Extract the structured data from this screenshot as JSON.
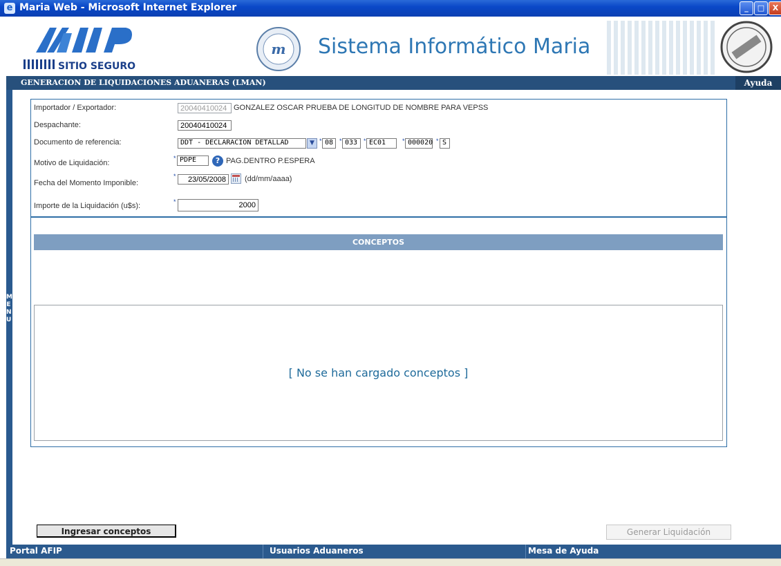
{
  "window": {
    "title": "Maria Web - Microsoft Internet Explorer",
    "min_glyph": "_",
    "max_glyph": "□",
    "close_glyph": "X"
  },
  "header": {
    "logo_text": "AFIP",
    "logo_subtext": "SITIO SEGURO",
    "system_title": "Sistema Informático Maria"
  },
  "section": {
    "title": "GENERACION DE LIQUIDACIONES ADUANERAS (LMAN)",
    "help_label": "Ayuda",
    "menu_label": "MENU"
  },
  "form": {
    "importador": {
      "label": "Importador / Exportador:",
      "cuit": "20040410024",
      "name": "GONZALEZ OSCAR PRUEBA DE LONGITUD DE NOMBRE PARA VEPSS"
    },
    "despachante": {
      "label": "Despachante:",
      "value": "20040410024"
    },
    "documento": {
      "label": "Documento de referencia:",
      "type_selected": "DDT - DECLARACION DETALLAD",
      "f1": "08",
      "f2": "033",
      "f3": "EC01",
      "f4": "000020",
      "f5": "S"
    },
    "motivo": {
      "label": "Motivo de Liquidación:",
      "value": "PDPE",
      "description": "PAG.DENTRO P.ESPERA"
    },
    "fecha": {
      "label": "Fecha del Momento Imponible:",
      "value": "23/05/2008",
      "format_hint": "(dd/mm/aaaa)"
    },
    "importe": {
      "label": "Importe de la Liquidación (u$s):",
      "value": "2000"
    },
    "required_mark": "*"
  },
  "conceptos": {
    "header": "CONCEPTOS",
    "empty_message": "[ No se han cargado conceptos ]"
  },
  "buttons": {
    "ingresar": "Ingresar conceptos",
    "generar": "Generar Liquidación"
  },
  "footer": {
    "portal": "Portal AFIP",
    "usuarios": "Usuarios Aduaneros",
    "mesa": "Mesa de Ayuda"
  }
}
